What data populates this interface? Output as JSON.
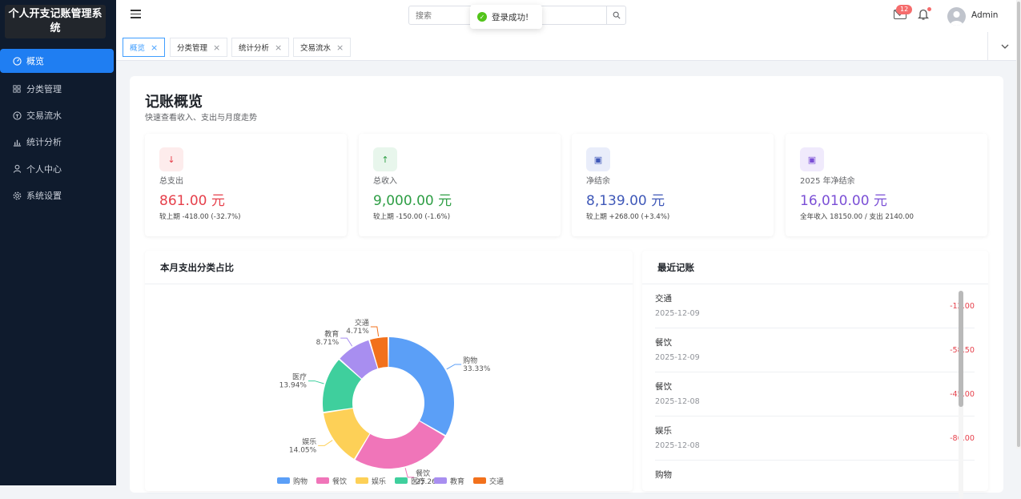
{
  "app": {
    "title": "个人开支记账管理系统"
  },
  "sidebar": {
    "items": [
      {
        "label": "概览",
        "icon": "dashboard-icon"
      },
      {
        "label": "分类管理",
        "icon": "grid-icon"
      },
      {
        "label": "交易流水",
        "icon": "swap-icon"
      },
      {
        "label": "统计分析",
        "icon": "bar-chart-icon"
      },
      {
        "label": "个人中心",
        "icon": "user-icon"
      },
      {
        "label": "系统设置",
        "icon": "gear-icon"
      }
    ]
  },
  "header": {
    "search_placeholder": "搜索",
    "toast": "登录成功!",
    "mail_badge": "12",
    "username": "Admin"
  },
  "tabs": [
    {
      "label": "概览",
      "active": true
    },
    {
      "label": "分类管理",
      "active": false
    },
    {
      "label": "统计分析",
      "active": false
    },
    {
      "label": "交易流水",
      "active": false
    }
  ],
  "overview": {
    "title": "记账概览",
    "subtitle": "快速查看收入、支出与月度走势",
    "cards": [
      {
        "label": "总支出",
        "value": "861.00 元",
        "note": "较上期 -418.00 (-32.7%)",
        "color": "#e6404b",
        "icon_bg": "#fdecec",
        "icon": "↓"
      },
      {
        "label": "总收入",
        "value": "9,000.00 元",
        "note": "较上期 -150.00 (-1.6%)",
        "color": "#2e9e45",
        "icon_bg": "#e8f6ec",
        "icon": "↑"
      },
      {
        "label": "净结余",
        "value": "8,139.00 元",
        "note": "较上期 +268.00 (+3.4%)",
        "color": "#3f58b8",
        "icon_bg": "#e9edfa",
        "icon": "▣"
      },
      {
        "label": "2025 年净结余",
        "value": "16,010.00 元",
        "note": "全年收入 18150.00 / 支出 2140.00",
        "color": "#7b4fd6",
        "icon_bg": "#f0eafc",
        "icon": "▣"
      }
    ]
  },
  "pie_section": {
    "title": "本月支出分类占比"
  },
  "recent": {
    "title": "最近记账",
    "items": [
      {
        "name": "交通",
        "date": "2025-12-09",
        "amount": "-12.00"
      },
      {
        "name": "餐饮",
        "date": "2025-12-09",
        "amount": "-58.50"
      },
      {
        "name": "餐饮",
        "date": "2025-12-08",
        "amount": "-45.00"
      },
      {
        "name": "娱乐",
        "date": "2025-12-08",
        "amount": "-86.00"
      },
      {
        "name": "购物",
        "date": "",
        "amount": ""
      }
    ]
  },
  "chart_data": {
    "type": "pie",
    "title": "",
    "categories": [
      "购物",
      "餐饮",
      "娱乐",
      "医疗",
      "教育",
      "交通"
    ],
    "values": [
      33.33,
      25.26,
      14.05,
      13.94,
      8.71,
      4.71
    ],
    "labels": [
      "33.33%",
      "25.26%",
      "14.05%",
      "13.94%",
      "8.71%",
      "4.71%"
    ],
    "colors": [
      "#5b9ff7",
      "#f075b9",
      "#fdd057",
      "#3fcf9d",
      "#a88ef0",
      "#f2711c"
    ],
    "legend": "bottom"
  }
}
